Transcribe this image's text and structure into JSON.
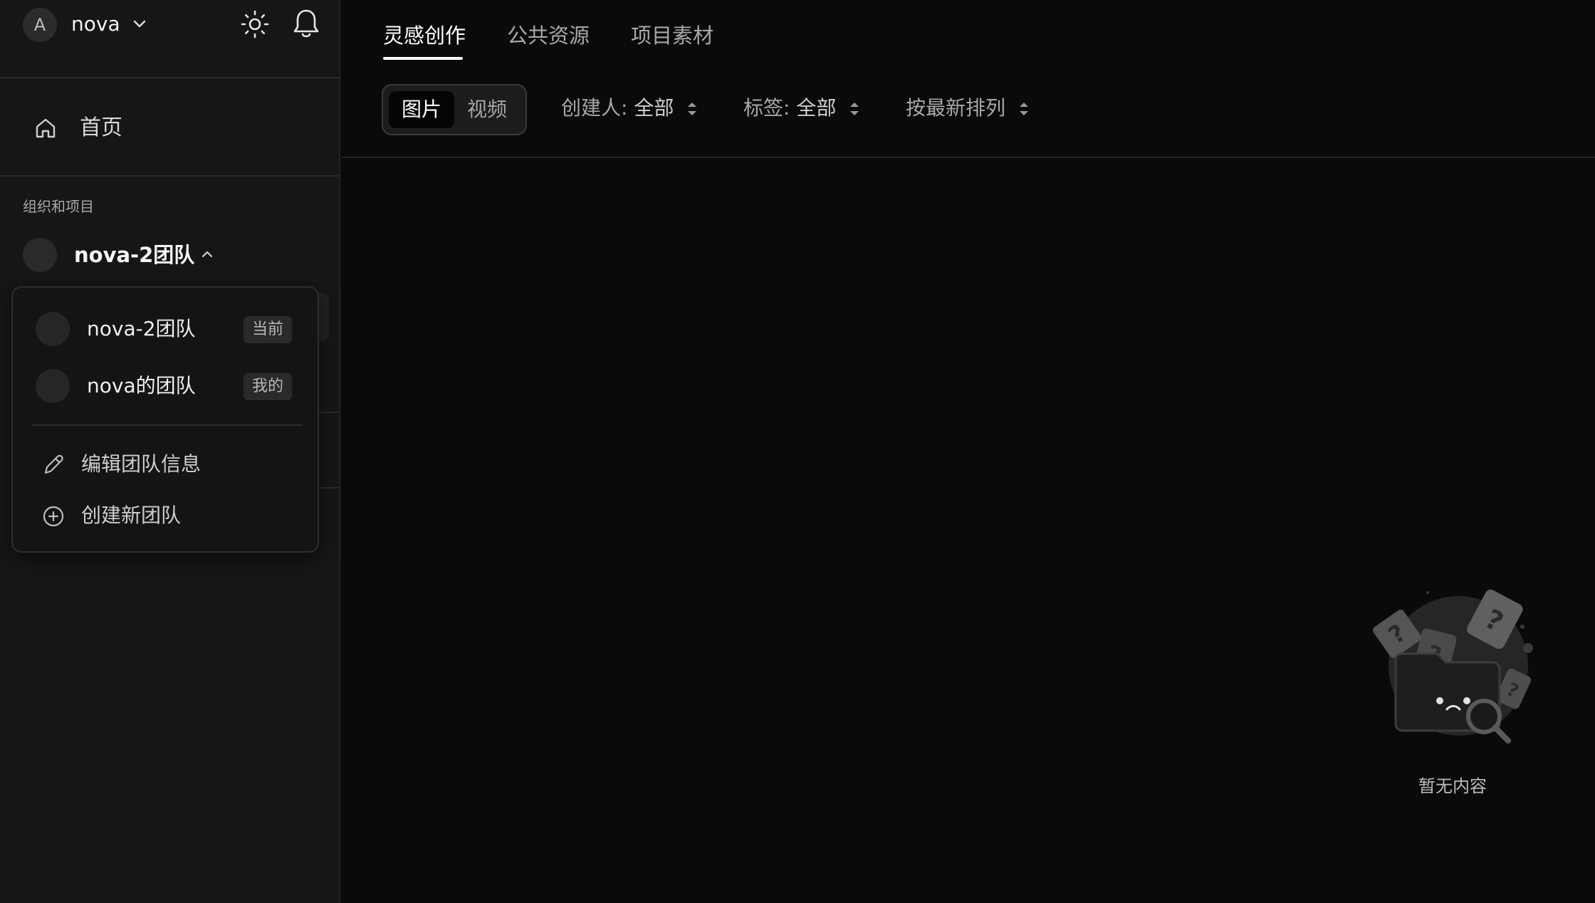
{
  "header": {
    "user_avatar_letter": "A",
    "user_name": "nova"
  },
  "sidebar": {
    "home_label": "首页",
    "section_label": "组织和项目",
    "current_team": "nova-2团队"
  },
  "dropdown": {
    "teams": [
      {
        "name": "nova-2团队",
        "badge": "当前"
      },
      {
        "name": "nova的团队",
        "badge": "我的"
      }
    ],
    "actions": [
      {
        "label": "编辑团队信息",
        "icon": "pencil-icon"
      },
      {
        "label": "创建新团队",
        "icon": "plus-circle-icon"
      }
    ]
  },
  "main": {
    "tabs": [
      {
        "label": "灵感创作",
        "active": true
      },
      {
        "label": "公共资源",
        "active": false
      },
      {
        "label": "项目素材",
        "active": false
      }
    ],
    "media_toggle": [
      "图片",
      "视频"
    ],
    "filters": {
      "creator_label": "创建人:",
      "creator_value": "全部",
      "tag_label": "标签:",
      "tag_value": "全部",
      "sort_label": "按最新排列"
    },
    "empty_text": "暂无内容"
  },
  "colors": {
    "background": "#0a0a0a",
    "sidebar": "#161616",
    "accent": "#ffffff"
  }
}
